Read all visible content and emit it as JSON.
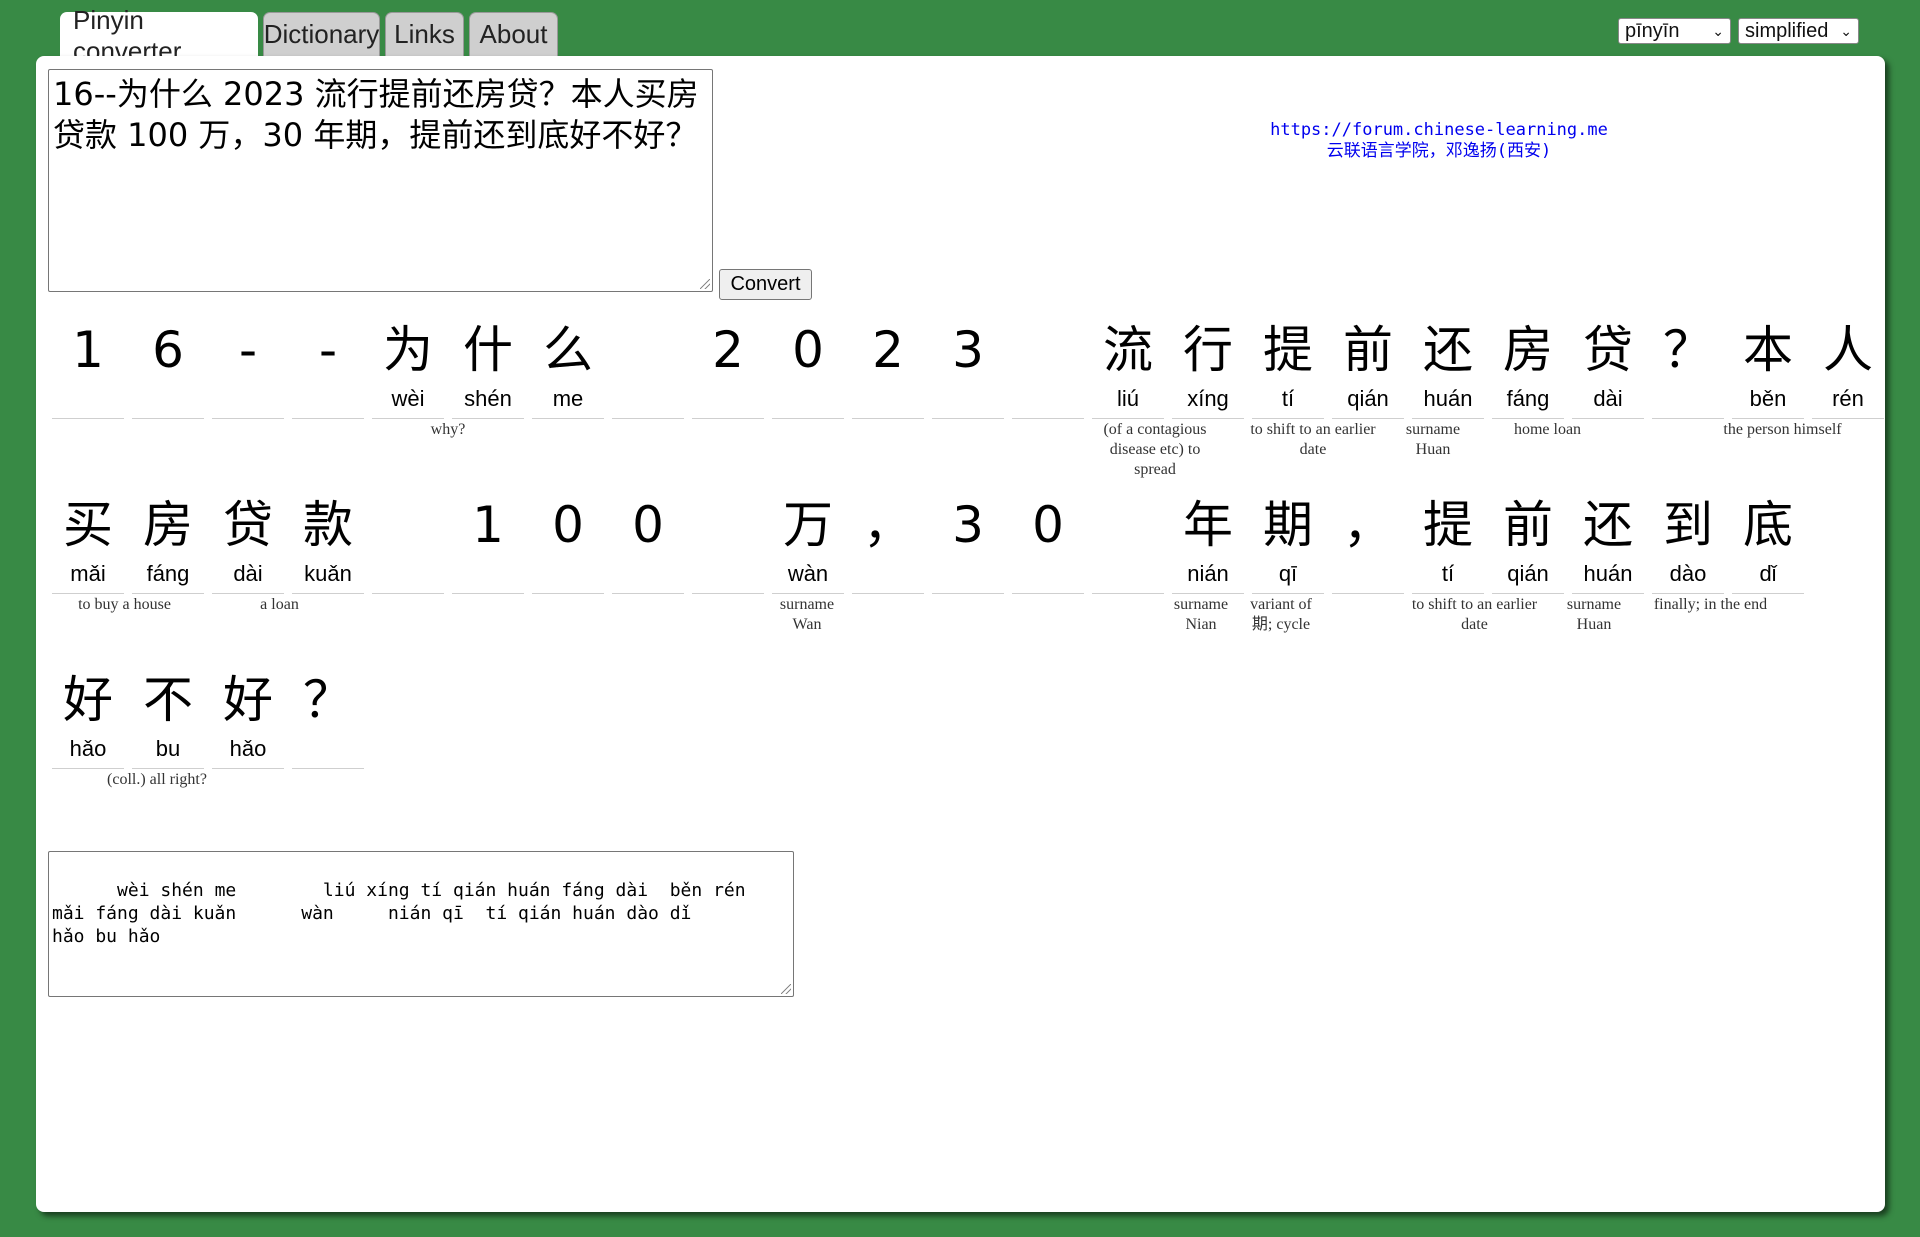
{
  "tabs": [
    {
      "label": "Pinyin converter",
      "active": true
    },
    {
      "label": "Dictionary",
      "active": false
    },
    {
      "label": "Links",
      "active": false
    },
    {
      "label": "About",
      "active": false
    }
  ],
  "selects": {
    "romanization": {
      "value": "pīnyīn"
    },
    "script": {
      "value": "simplified"
    }
  },
  "input": {
    "text": "16--为什么 2023 流行提前还房贷？本人买房贷款 100 万，30 年期，提前还到底好不好？"
  },
  "convert_button": {
    "label": "Convert"
  },
  "credit": {
    "url": "https://forum.chinese-learning.me",
    "name": "云联语言学院，邓逸扬(西安)"
  },
  "tokens": [
    [
      {
        "hz": "1",
        "py": ""
      },
      {
        "hz": "6",
        "py": ""
      },
      {
        "hz": "-",
        "py": ""
      },
      {
        "hz": "-",
        "py": ""
      },
      {
        "hz": "为",
        "py": "wèi"
      },
      {
        "hz": "什",
        "py": "shén"
      },
      {
        "hz": "么",
        "py": "me"
      },
      {
        "hz": "",
        "py": ""
      },
      {
        "hz": "2",
        "py": ""
      },
      {
        "hz": "0",
        "py": ""
      },
      {
        "hz": "2",
        "py": ""
      },
      {
        "hz": "3",
        "py": ""
      },
      {
        "hz": "",
        "py": ""
      },
      {
        "hz": "流",
        "py": "liú"
      },
      {
        "hz": "行",
        "py": "xíng"
      },
      {
        "hz": "提",
        "py": "tí"
      },
      {
        "hz": "前",
        "py": "qián"
      },
      {
        "hz": "还",
        "py": "huán"
      },
      {
        "hz": "房",
        "py": "fáng"
      },
      {
        "hz": "贷",
        "py": "dài"
      },
      {
        "hz": "？",
        "py": ""
      },
      {
        "hz": "本",
        "py": "běn"
      },
      {
        "hz": "人",
        "py": "rén"
      }
    ],
    [
      {
        "hz": "买",
        "py": "mǎi"
      },
      {
        "hz": "房",
        "py": "fáng"
      },
      {
        "hz": "贷",
        "py": "dài"
      },
      {
        "hz": "款",
        "py": "kuǎn"
      },
      {
        "hz": "",
        "py": ""
      },
      {
        "hz": "1",
        "py": ""
      },
      {
        "hz": "0",
        "py": ""
      },
      {
        "hz": "0",
        "py": ""
      },
      {
        "hz": "",
        "py": ""
      },
      {
        "hz": "万",
        "py": "wàn"
      },
      {
        "hz": "，",
        "py": ""
      },
      {
        "hz": "3",
        "py": ""
      },
      {
        "hz": "0",
        "py": ""
      },
      {
        "hz": "",
        "py": ""
      },
      {
        "hz": "年",
        "py": "nián"
      },
      {
        "hz": "期",
        "py": "qī"
      },
      {
        "hz": "，",
        "py": ""
      },
      {
        "hz": "提",
        "py": "tí"
      },
      {
        "hz": "前",
        "py": "qián"
      },
      {
        "hz": "还",
        "py": "huán"
      },
      {
        "hz": "到",
        "py": "dào"
      },
      {
        "hz": "底",
        "py": "dǐ"
      }
    ],
    [
      {
        "hz": "好",
        "py": "hǎo"
      },
      {
        "hz": "不",
        "py": "bu"
      },
      {
        "hz": "好",
        "py": "hǎo"
      },
      {
        "hz": "？",
        "py": ""
      }
    ]
  ],
  "glosses": [
    {
      "text": "why?"
    },
    {
      "text": "(of a contagious disease etc) to spread"
    },
    {
      "text": "to shift to an earlier date"
    },
    {
      "text": "surname Huan"
    },
    {
      "text": "home loan"
    },
    {
      "text": "the person himself"
    },
    {
      "text": "to buy a house"
    },
    {
      "text": "a loan"
    },
    {
      "text": "surname Wan"
    },
    {
      "text": "surname Nian"
    },
    {
      "text": "variant of 期; cycle"
    },
    {
      "text": "to shift to an earlier date"
    },
    {
      "text": "surname Huan"
    },
    {
      "text": "finally; in the end"
    },
    {
      "text": "(coll.) all right?"
    }
  ],
  "output": {
    "text": "    wèi shén me        liú xíng tí qián huán fáng dài  běn rén\nmǎi fáng dài kuǎn      wàn     nián qī  tí qián huán dào dǐ\nhǎo bu hǎo"
  }
}
